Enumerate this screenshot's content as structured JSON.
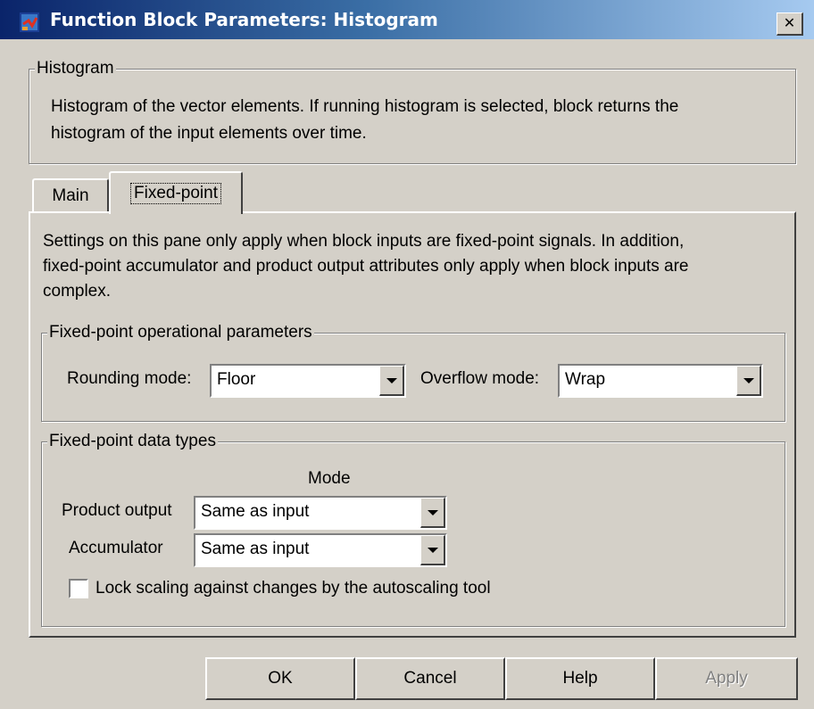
{
  "window": {
    "title": "Function Block Parameters: Histogram",
    "close_glyph": "✕"
  },
  "histogram_group": {
    "legend": "Histogram",
    "description_line1": "Histogram of the vector elements.  If running histogram is selected, block returns the",
    "description_line2": "histogram of the input elements over time."
  },
  "tabs": [
    {
      "label": "Main",
      "selected": false
    },
    {
      "label": "Fixed-point",
      "selected": true
    }
  ],
  "fixed_point_pane": {
    "description_line1": "Settings on this pane only apply when block inputs are fixed-point signals. In addition,",
    "description_line2": "fixed-point accumulator and product output attributes only apply when block inputs are",
    "description_line3": "complex.",
    "operational": {
      "legend": "Fixed-point operational parameters",
      "rounding_label": "Rounding mode:",
      "rounding_value": "Floor",
      "overflow_label": "Overflow mode:",
      "overflow_value": "Wrap"
    },
    "data_types": {
      "legend": "Fixed-point data types",
      "mode_header": "Mode",
      "product_output_label": "Product output",
      "product_output_value": "Same as input",
      "accumulator_label": "Accumulator",
      "accumulator_value": "Same as input",
      "lock_scaling_label": "Lock scaling against changes by the autoscaling tool",
      "lock_scaling_checked": false
    }
  },
  "buttons": {
    "ok": "OK",
    "cancel": "Cancel",
    "help": "Help",
    "apply": "Apply"
  },
  "colors": {
    "face": "#d4d0c8",
    "titlebar_start": "#0a246a",
    "titlebar_end": "#a6caf0"
  }
}
